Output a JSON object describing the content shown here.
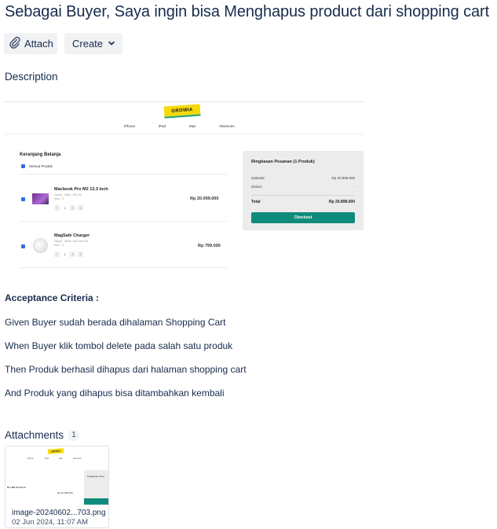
{
  "issue": {
    "title": "Sebagai Buyer, Saya ingin bisa Menghapus product dari shopping cart"
  },
  "toolbar": {
    "attach_label": "Attach",
    "create_label": "Create"
  },
  "description": {
    "heading": "Description",
    "screenshot": {
      "logo_text": "GROWIA",
      "nav": [
        "iPhone",
        "iPad",
        "Mac",
        "Aksesoris"
      ],
      "cart_title": "Keranjang Belanja",
      "select_all": "Semua Produk",
      "products": [
        {
          "name": "Macbook Pro M2 13.3 inch",
          "variant": "Varian : Silver, 256 Gb",
          "stock": "Stok : 3",
          "qty": "1",
          "price": "Rp 20.099.000"
        },
        {
          "name": "MagSafe Charger",
          "variant": "Varian : White, One Size Fit",
          "stock": "Stok : 3",
          "qty": "1",
          "price": "Rp 799.000"
        }
      ],
      "summary": {
        "title": "Ringkasan Pesanan (1 Produk)",
        "subtotal_label": "Subtotal",
        "subtotal_value": "Rp 20.898.000",
        "discount_label": "Diskon",
        "discount_value": "-",
        "total_label": "Total",
        "total_value": "Rp 20.898.000",
        "checkout_label": "Checkout"
      }
    }
  },
  "acceptance": {
    "heading": "Acceptance Criteria :",
    "lines": [
      "Given Buyer sudah berada dihalaman Shopping Cart",
      "When Buyer klik tombol delete pada salah satu produk",
      "Then Produk berhasil dihapus dari halaman shopping cart",
      "And Produk yang dihapus bisa ditambahkan kembali"
    ]
  },
  "attachments": {
    "heading": "Attachments",
    "count": "1",
    "items": [
      {
        "filename": "image-20240602...703.png",
        "date": "02 Jun 2024, 11:07 AM",
        "thumb_logo": "GROWIA",
        "thumb_nav": [
          "iPhone",
          "iPad",
          "Mac",
          "Aksesoris"
        ],
        "thumb_product": "Pro M2 13.3 inch",
        "thumb_price": "Rp 20.099.000",
        "thumb_summary_title": "Ringkasan Pesa"
      }
    ]
  },
  "colors": {
    "text": "#172b4d",
    "button_bg": "#f1f2f4",
    "checkout": "#0f8b7b",
    "logo_yellow": "#f5d90a",
    "checkbox": "#2f6fe0"
  }
}
